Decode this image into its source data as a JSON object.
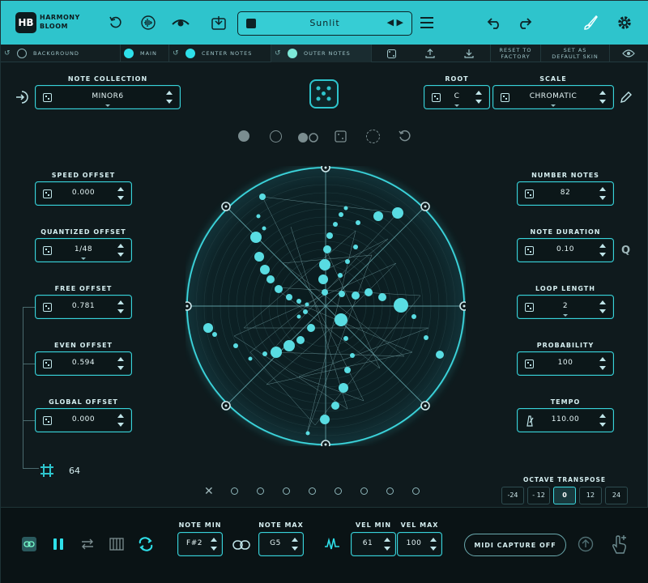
{
  "app": {
    "logo_abbr": "HB",
    "logo_line1": "HARMONY",
    "logo_line2": "BLOOM"
  },
  "preset": {
    "name": "Sunlit",
    "arrows": "◀ ▶"
  },
  "subbar": {
    "background_label": "BACKGROUND",
    "main_label": "MAIN",
    "center_notes_label": "CENTER NOTES",
    "outer_notes_label": "OUTER NOTES",
    "reset_factory_line1": "RESET TO",
    "reset_factory_line2": "FACTORY",
    "set_default_line1": "SET AS",
    "set_default_line2": "DEFAULT SKIN",
    "colors": {
      "background": "#0f1a1d",
      "main": "#2ee0ea",
      "center": "#2ee0ea",
      "outer": "#7de8d8"
    }
  },
  "left_controls": {
    "note_collection": {
      "label": "NOTE COLLECTION",
      "value": "MINOR6"
    },
    "speed_offset": {
      "label": "SPEED OFFSET",
      "value": "0.000"
    },
    "quantized_offset": {
      "label": "QUANTIZED OFFSET",
      "value": "1/48"
    },
    "free_offset": {
      "label": "FREE OFFSET",
      "value": "0.781"
    },
    "even_offset": {
      "label": "EVEN OFFSET",
      "value": "0.594"
    },
    "global_offset": {
      "label": "GLOBAL OFFSET",
      "value": "0.000"
    },
    "grid_value": "64"
  },
  "right_controls": {
    "root": {
      "label": "ROOT",
      "value": "C"
    },
    "scale": {
      "label": "SCALE",
      "value": "CHROMATIC"
    },
    "number_notes": {
      "label": "NUMBER NOTES",
      "value": "82"
    },
    "note_duration": {
      "label": "NOTE DURATION",
      "value": "0.10"
    },
    "loop_length": {
      "label": "LOOP LENGTH",
      "value": "2"
    },
    "probability": {
      "label": "PROBABILITY",
      "value": "100"
    },
    "tempo": {
      "label": "TEMPO",
      "value": "110.00"
    },
    "q_label": "Q"
  },
  "octave_transpose": {
    "label": "OCTAVE TRANSPOSE",
    "options": [
      "-24",
      "- 12",
      "0",
      "12",
      "24"
    ],
    "selected": "0"
  },
  "bottom": {
    "note_min": {
      "label": "NOTE MIN",
      "value": "F#2"
    },
    "note_max": {
      "label": "NOTE MAX",
      "value": "G5"
    },
    "vel_min": {
      "label": "VEL MIN",
      "value": "61"
    },
    "vel_max": {
      "label": "VEL MAX",
      "value": "100"
    },
    "midi_capture": "MIDI CAPTURE OFF"
  },
  "accent_color": "#2ec4cc"
}
